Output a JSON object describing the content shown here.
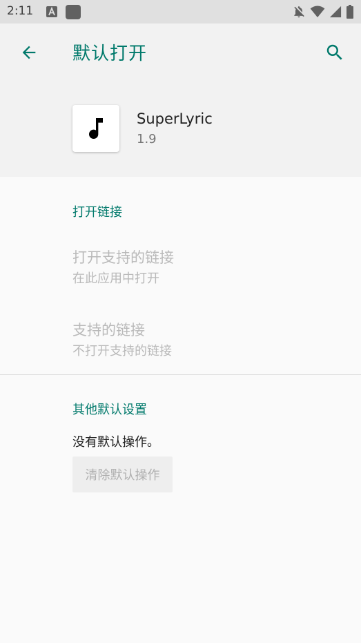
{
  "status_bar": {
    "time": "2:11",
    "icons": [
      "text-notification-icon",
      "app-notification-icon",
      "notifications-off-icon",
      "wifi-icon",
      "signal-icon",
      "battery-icon"
    ]
  },
  "toolbar": {
    "title": "默认打开",
    "back_icon": "arrow-back-icon",
    "search_icon": "search-icon"
  },
  "app": {
    "name": "SuperLyric",
    "version": "1.9",
    "icon": "music-note-icon"
  },
  "open_links": {
    "section_title": "打开链接",
    "open_supported": {
      "title": "打开支持的链接",
      "summary": "在此应用中打开"
    },
    "supported_links": {
      "title": "支持的链接",
      "summary": "不打开支持的链接"
    }
  },
  "other_defaults": {
    "section_title": "其他默认设置",
    "no_defaults": "没有默认操作。",
    "clear_label": "清除默认操作"
  },
  "colors": {
    "accent": "#00796b",
    "status_bar": "#e0e0e0",
    "header_bg": "#f2f2f2",
    "disabled_text": "#b9b9b9"
  }
}
